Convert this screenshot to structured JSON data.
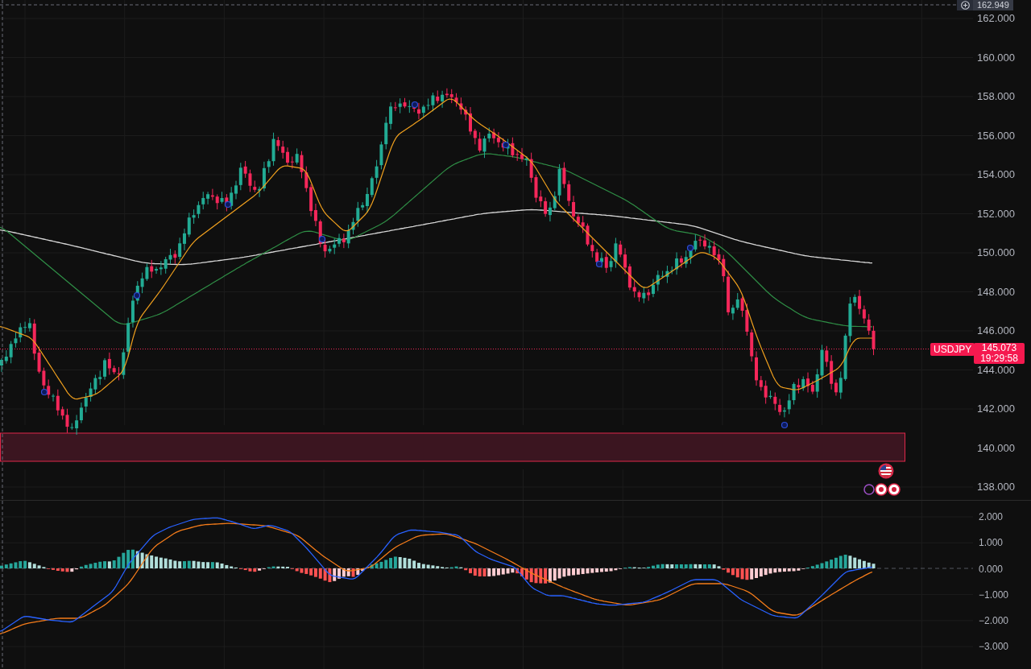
{
  "price_pane": {
    "crosshair_price": "162.949",
    "symbol_tag": "USDJPY",
    "last_price": "145.073",
    "bar_countdown": "19:29:58",
    "axis_labels": [
      "162.000",
      "160.000",
      "158.000",
      "156.000",
      "154.000",
      "152.000",
      "150.000",
      "148.000",
      "146.000",
      "144.000",
      "142.000",
      "140.000",
      "138.000"
    ]
  },
  "macd_pane": {
    "axis_labels": [
      "2.000",
      "1.000",
      "0.000",
      "−1.000",
      "−2.000",
      "−3.000"
    ]
  }
}
